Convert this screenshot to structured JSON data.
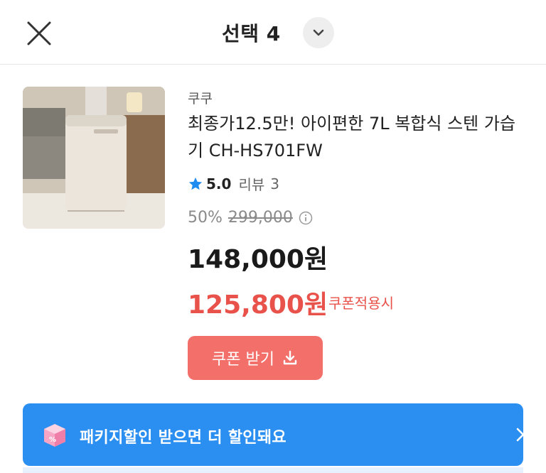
{
  "header": {
    "title": "선택 4",
    "close_icon": "close-icon",
    "expand_icon": "chevron-down-icon"
  },
  "product": {
    "brand": "쿠쿠",
    "name": "최종가12.5만! 아이편한 7L 복합식 스텐 가습기 CH-HS701FW",
    "rating": {
      "score": "5.0",
      "label": "리뷰",
      "count": "3",
      "star_color": "#1e8cf0"
    },
    "discount_rate": "50%",
    "original_price": "299,000",
    "price": "148,000원",
    "coupon_price": "125,800원",
    "coupon_note": "쿠폰적용시",
    "coupon_button_label": "쿠폰 받기"
  },
  "banner": {
    "text": "패키지할인 받으면 더 할인돼요",
    "icon": "package-box-icon",
    "color": "#2a8ff0"
  },
  "colors": {
    "accent_red": "#e9524a",
    "coupon_button": "#f36f6a"
  }
}
